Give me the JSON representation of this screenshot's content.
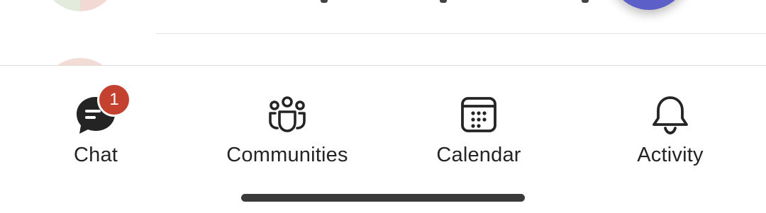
{
  "colors": {
    "badge": "#c4412f",
    "fab": "#5b5fc7",
    "icon": "#242424",
    "home_indicator": "#3a3a3a"
  },
  "nav": {
    "items": [
      {
        "label": "Chat",
        "icon": "chat-icon",
        "badge": "1"
      },
      {
        "label": "Communities",
        "icon": "communities-icon"
      },
      {
        "label": "Calendar",
        "icon": "calendar-icon"
      },
      {
        "label": "Activity",
        "icon": "bell-icon"
      }
    ]
  }
}
